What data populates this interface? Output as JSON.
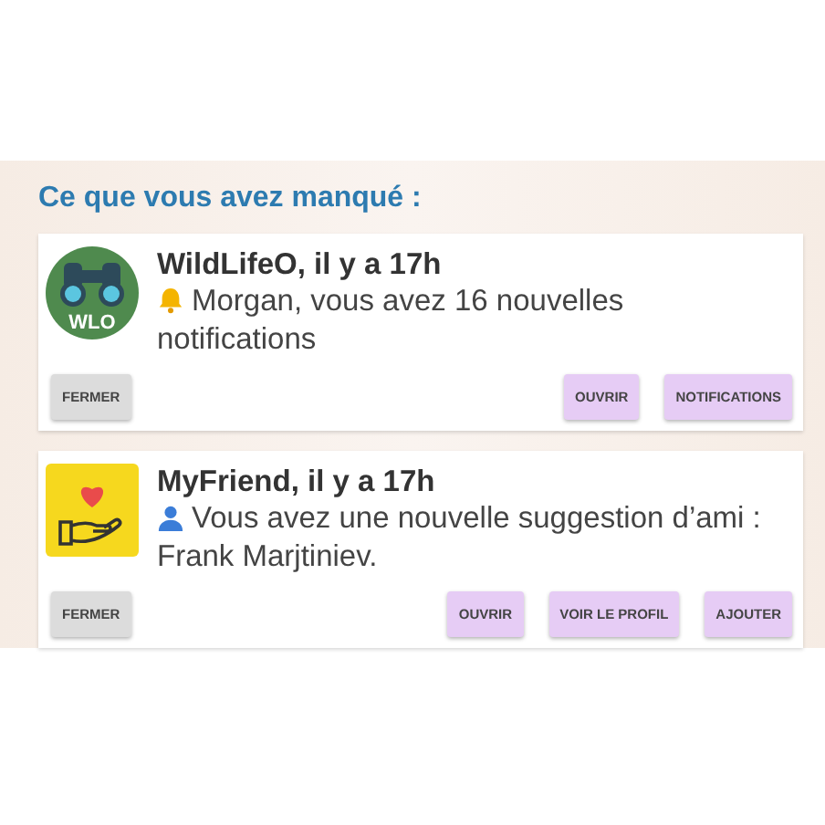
{
  "heading": "Ce que vous avez manqué :",
  "notifications": [
    {
      "kind": "alert",
      "avatar_text": "WLO",
      "title": "WildLifeO, il y a 17h",
      "message": "Morgan, vous avez 16 nouvelles notifications",
      "buttons": [
        {
          "label": "FERMER",
          "kind": "dismiss"
        },
        {
          "label": "OUVRIR",
          "kind": "action"
        },
        {
          "label": "NOTIFICATIONS",
          "kind": "action"
        }
      ]
    },
    {
      "kind": "suggestion",
      "title": "MyFriend, il y a 17h",
      "message": "Vous avez une nouvelle suggestion d’ami : Frank Marjtiniev.",
      "buttons": [
        {
          "label": "FERMER",
          "kind": "dismiss"
        },
        {
          "label": "OUVRIR",
          "kind": "action"
        },
        {
          "label": "VOIR LE PROFIL",
          "kind": "action"
        },
        {
          "label": "AJOUTER",
          "kind": "action"
        }
      ]
    }
  ]
}
